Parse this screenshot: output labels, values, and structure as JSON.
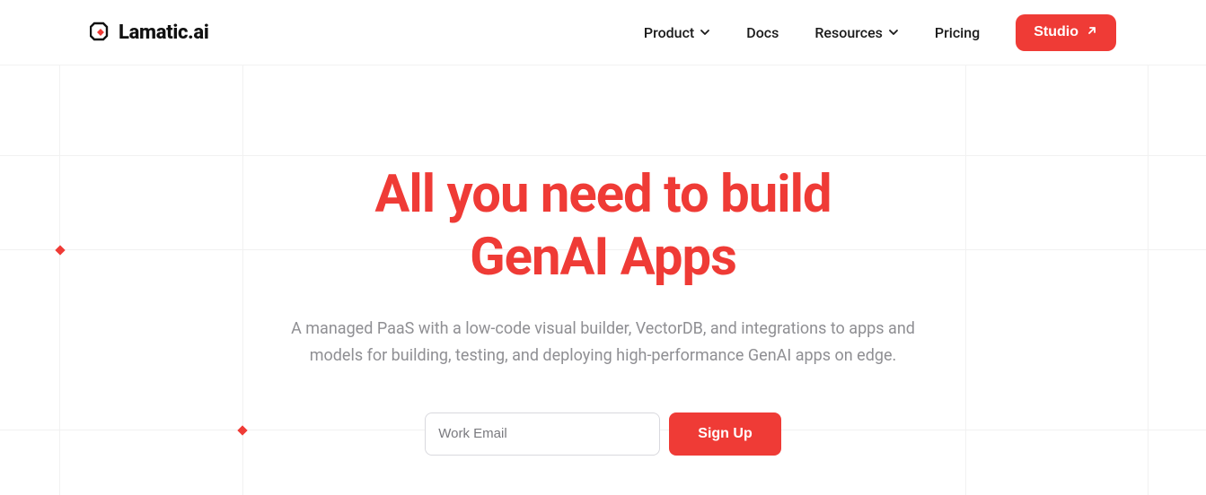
{
  "brand": {
    "name": "Lamatic.ai"
  },
  "nav": {
    "product": "Product",
    "docs": "Docs",
    "resources": "Resources",
    "pricing": "Pricing",
    "studio": "Studio"
  },
  "hero": {
    "title_line1": "All you need to build",
    "title_line2": "GenAI Apps",
    "subtitle": "A managed PaaS with a low-code visual builder, VectorDB, and integrations to apps and models for building, testing, and deploying high-performance GenAI apps on edge."
  },
  "signup": {
    "email_placeholder": "Work Email",
    "button": "Sign Up"
  },
  "colors": {
    "accent": "#ef3b36"
  }
}
